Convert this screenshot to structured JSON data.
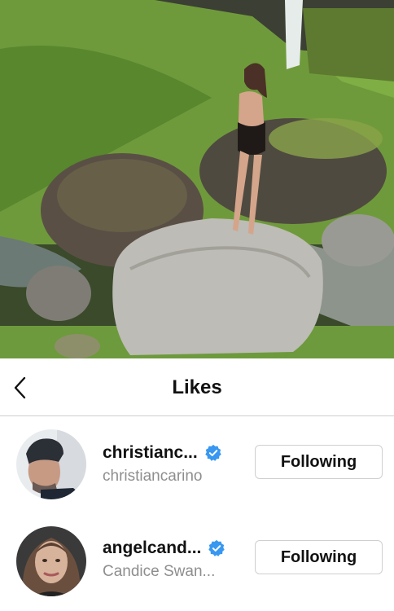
{
  "header": {
    "title": "Likes",
    "back_icon": "chevron-left-icon"
  },
  "likes": [
    {
      "username": "christianc...",
      "subtitle": "christiancarino",
      "verified": true,
      "button_label": "Following"
    },
    {
      "username": "angelcand...",
      "subtitle": "Candice Swan...",
      "verified": true,
      "button_label": "Following"
    }
  ],
  "colors": {
    "verified_blue": "#3897f0",
    "subtitle_gray": "#8e8e8e",
    "divider": "#cfcfcf"
  }
}
